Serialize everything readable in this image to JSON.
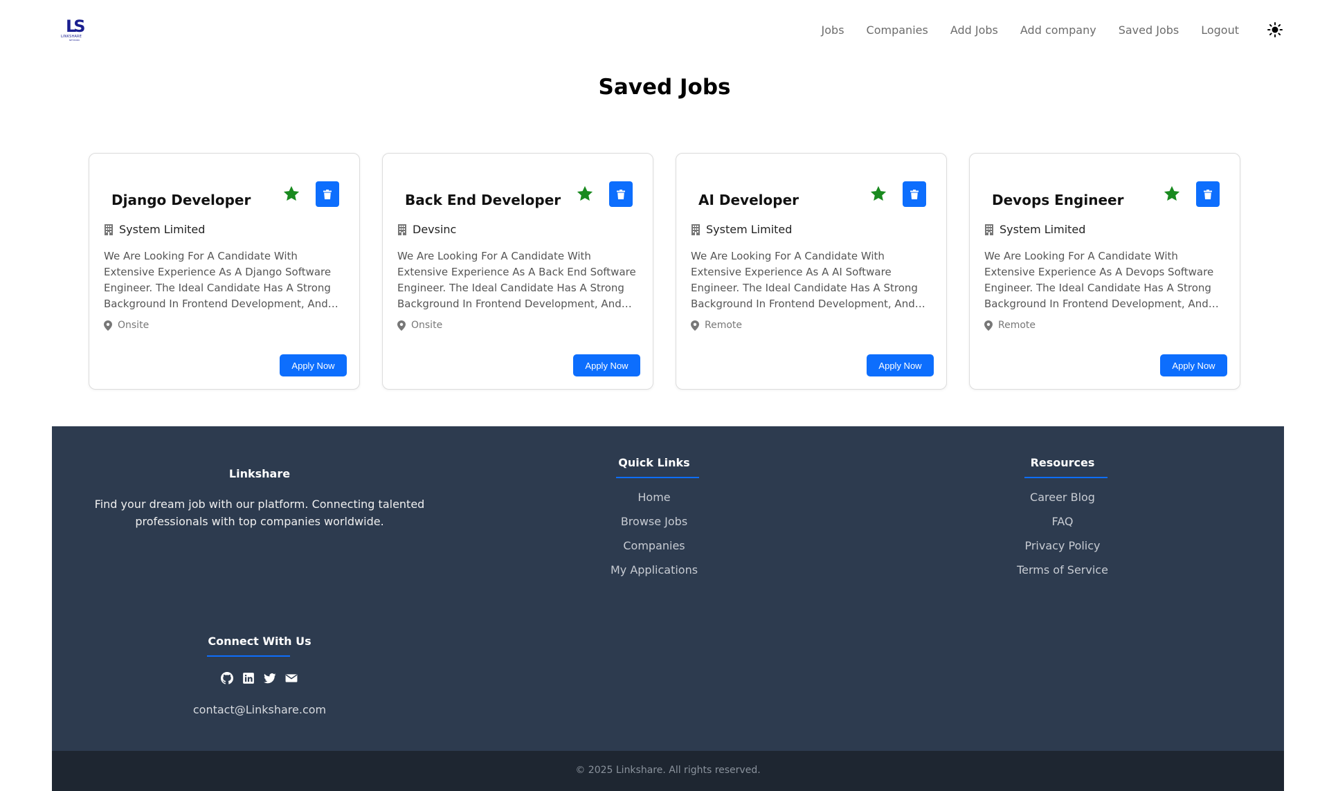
{
  "brand": {
    "logo_mark": "LS",
    "logo_text": "LINKSHARE",
    "logo_sub": "NETWORK"
  },
  "nav": {
    "items": [
      {
        "label": "Jobs"
      },
      {
        "label": "Companies"
      },
      {
        "label": "Add Jobs"
      },
      {
        "label": "Add company"
      },
      {
        "label": "Saved Jobs"
      },
      {
        "label": "Logout"
      }
    ],
    "theme_icon": "sun-icon"
  },
  "page": {
    "title": "Saved Jobs"
  },
  "colors": {
    "primary": "#0d6efd",
    "star": "#198a1f",
    "footer_bg": "#2d3b4f",
    "copyright_bg": "#1e2631"
  },
  "jobs": [
    {
      "title": "Django Developer",
      "company": "System Limited",
      "description": "We Are Looking For A Candidate With Extensive Experience As A Django Software Engineer. The Ideal Candidate Has A Strong Background In Frontend Development, And Is...",
      "location": "Onsite",
      "apply_label": "Apply Now"
    },
    {
      "title": "Back End Developer",
      "company": "Devsinc",
      "description": "We Are Looking For A Candidate With Extensive Experience As A Back End Software Engineer. The Ideal Candidate Has A Strong Background In Frontend Development, And Is...",
      "location": "Onsite",
      "apply_label": "Apply Now"
    },
    {
      "title": "AI Developer",
      "company": "System Limited",
      "description": "We Are Looking For A Candidate With Extensive Experience As A AI Software Engineer. The Ideal Candidate Has A Strong Background In Frontend Development, And Is...",
      "location": "Remote",
      "apply_label": "Apply Now"
    },
    {
      "title": "Devops Engineer",
      "company": "System Limited",
      "description": "We Are Looking For A Candidate With Extensive Experience As A Devops Software Engineer. The Ideal Candidate Has A Strong Background In Frontend Development, And Is...",
      "location": "Remote",
      "apply_label": "Apply Now"
    }
  ],
  "footer": {
    "about": {
      "title": "Linkshare",
      "text": "Find your dream job with our platform. Connecting talented professionals with top companies worldwide."
    },
    "quick_links": {
      "title": "Quick Links",
      "items": [
        "Home",
        "Browse Jobs",
        "Companies",
        "My Applications"
      ]
    },
    "resources": {
      "title": "Resources",
      "items": [
        "Career Blog",
        "FAQ",
        "Privacy Policy",
        "Terms of Service"
      ]
    },
    "connect": {
      "title": "Connect With Us",
      "icons": [
        "github-icon",
        "linkedin-icon",
        "twitter-icon",
        "envelope-icon"
      ],
      "email": "contact@Linkshare.com"
    },
    "copyright": "© 2025 Linkshare. All rights reserved."
  }
}
